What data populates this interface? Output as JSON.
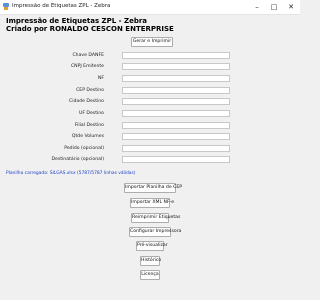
{
  "window": {
    "title": "Impressão de Etiquetas ZPL - Zebra",
    "icon": "app-icon",
    "controls": {
      "minimize": "–",
      "maximize": "□",
      "close": "✕"
    }
  },
  "header": {
    "title": "Impressão de Etiquetas ZPL - Zebra",
    "subtitle": "Criado por RONALDO CESCON ENTERPRISE"
  },
  "top_button": "Gerar e Imprimir",
  "fields": [
    {
      "label": "Chave DANFE",
      "value": ""
    },
    {
      "label": "CNPJ Emitente",
      "value": ""
    },
    {
      "label": "NF",
      "value": ""
    },
    {
      "label": "CEP Destino",
      "value": ""
    },
    {
      "label": "Cidade Destino",
      "value": ""
    },
    {
      "label": "UF Destino",
      "value": ""
    },
    {
      "label": "Filial Destino",
      "value": ""
    },
    {
      "label": "Qtde Volumes",
      "value": ""
    },
    {
      "label": "Pedido (opcional)",
      "value": ""
    },
    {
      "label": "Destinatário (opcional)",
      "value": ""
    }
  ],
  "status_text": "Planilha carregada: SILGAS.xlsx (5787/5787 linhas válidas)",
  "actions": [
    "Importar Planilha de CEP",
    "Importar XML NF-e",
    "Reimprimir Etiquetas",
    "Configurar Impressora",
    "Pré-visualizar",
    "Histórico",
    "Licença"
  ],
  "colors": {
    "status": "#1a3fc4",
    "background": "#f0f0f0"
  }
}
